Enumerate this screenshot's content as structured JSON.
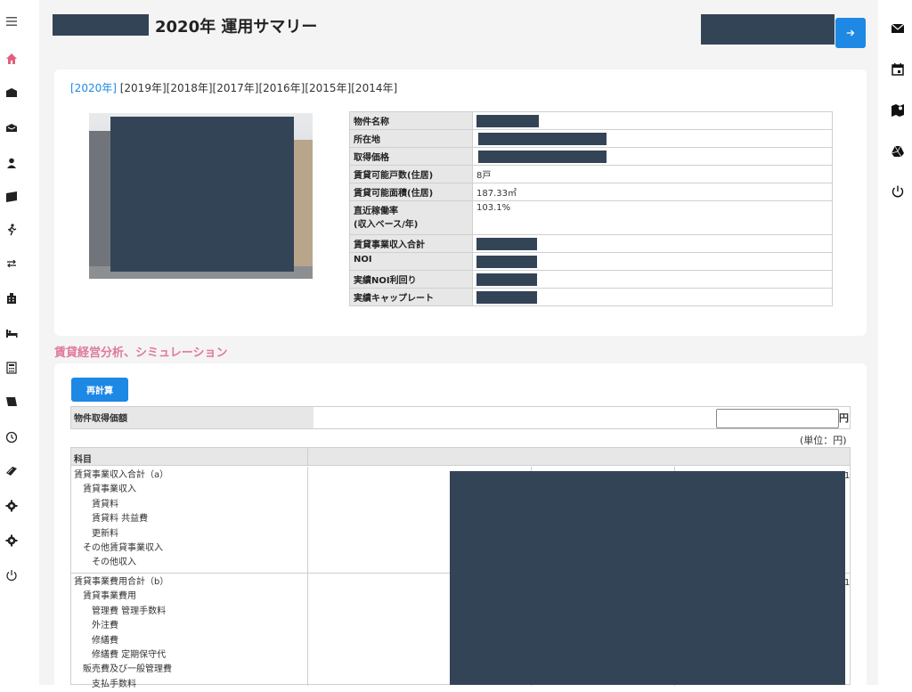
{
  "header": {
    "title": "2020年 運用サマリー"
  },
  "years": {
    "current": "[2020年]",
    "others": "[2019年][2018年][2017年][2016年][2015年][2014年]"
  },
  "info_table": [
    {
      "label": "物件名称",
      "value": "",
      "redacted": true
    },
    {
      "label": "所在地",
      "value": "",
      "redacted": true
    },
    {
      "label": "取得価格",
      "value": "",
      "redacted": true
    },
    {
      "label": "賃貸可能戸数(住居)",
      "value": "8戸",
      "redacted": false
    },
    {
      "label": "賃貸可能面積(住居)",
      "value": "187.33㎡",
      "redacted": false
    },
    {
      "label": "直近稼働率\n(収入ベース/年)",
      "value": "103.1%",
      "redacted": false
    },
    {
      "label": "賃貸事業収入合計",
      "value": "",
      "redacted": true
    },
    {
      "label": "NOI",
      "value": "",
      "redacted": true
    },
    {
      "label": "実績NOI利回り",
      "value": "",
      "redacted": true
    },
    {
      "label": "実績キャップレート",
      "value": "",
      "redacted": true
    }
  ],
  "simulation": {
    "section_title": "賃貸経営分析、シミュレーション",
    "recalc_label": "再計算",
    "acq_label": "物件取得価額",
    "acq_input_value": "",
    "yen": "円",
    "unit": "(単位：円)",
    "head_label": "科目",
    "income_lines": [
      "賃貸事業収入合計（a）",
      "　賃貸事業収入",
      "　　賃貸料",
      "　　賃貸料 共益費",
      "　　更新料",
      "　その他賃貸事業収入",
      "　　その他収入"
    ],
    "expense_lines": [
      "賃貸事業費用合計（b）",
      "　賃貸事業費用",
      "　　管理費 管理手数料",
      "　　外注費",
      "　　修繕費",
      "　　修繕費 定期保守代",
      "　販売費及び一般管理費",
      "　　支払手数料"
    ]
  },
  "left_nav": {
    "icons": [
      "menu-icon",
      "home-icon",
      "mail-icon",
      "mail-open-icon",
      "user-icon",
      "ticket-icon",
      "run-icon",
      "swap-icon",
      "building-icon",
      "bed-icon",
      "calculator-icon",
      "book-icon",
      "clock-icon",
      "book-open-icon",
      "gear-icon",
      "settings-icon",
      "power-icon"
    ]
  },
  "right_nav": {
    "icons": [
      "mail-icon",
      "calendar-icon",
      "map-icon",
      "drive-icon",
      "power-icon"
    ]
  },
  "colors": {
    "accent": "#1e88e5",
    "section": "#e07a9a",
    "redaction": "#344457"
  }
}
